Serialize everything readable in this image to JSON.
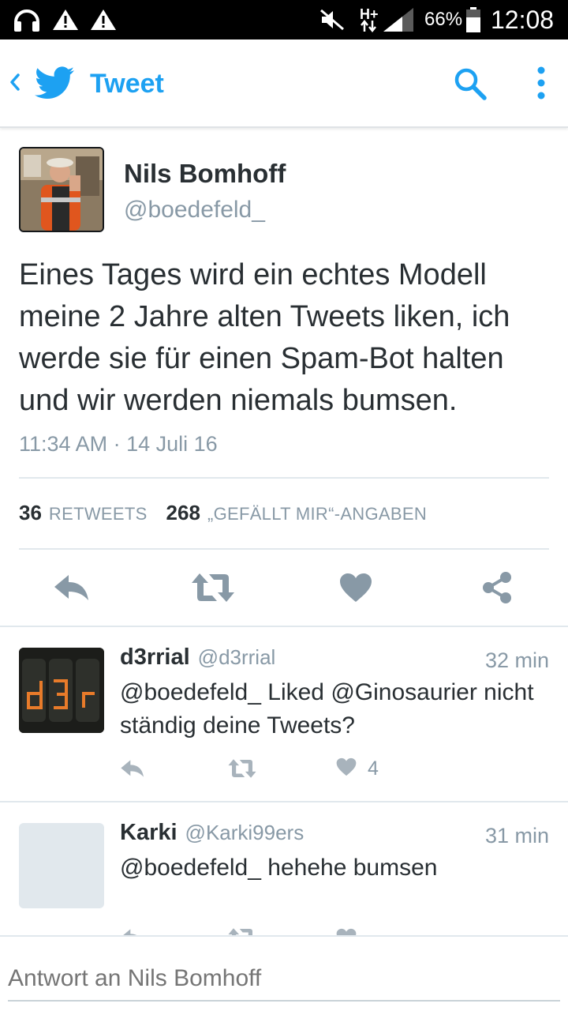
{
  "status_bar": {
    "network_type": "H+",
    "battery": "66%",
    "time": "12:08",
    "icons": [
      "headset-icon",
      "warning-icon",
      "warning-icon",
      "mute-icon",
      "signal-icon",
      "battery-icon"
    ]
  },
  "app_bar": {
    "title": "Tweet",
    "icons": [
      "back-chevron-icon",
      "twitter-bird-icon",
      "search-icon",
      "more-vert-icon"
    ],
    "accent_color": "#1da1f2"
  },
  "tweet": {
    "author_name": "Nils Bomhoff",
    "author_handle": "@boedefeld_",
    "text": "Eines Tages wird ein echtes Modell meine 2 Jahre alten Tweets liken, ich werde sie für einen Spam-Bot halten und wir werden niemals bumsen.",
    "timestamp": "11:34 AM · 14 Juli 16",
    "retweet_count": "36",
    "retweet_label": "RETWEETS",
    "like_count": "268",
    "like_label": "„GEFÄLLT MIR“-ANGABEN",
    "action_icons": [
      "reply-icon",
      "retweet-icon",
      "heart-icon",
      "share-icon"
    ]
  },
  "replies": [
    {
      "name": "d3rrial",
      "handle": "@d3rrial",
      "time": "32 min",
      "text": "@boedefeld_ Liked @Ginosaurier nicht ständig deine Tweets?",
      "like_count": "4",
      "avatar_text": "d3r"
    },
    {
      "name": "Karki",
      "handle": "@Karki99ers",
      "time": "31 min",
      "text": "@boedefeld_ hehehe bumsen",
      "like_count": ""
    }
  ],
  "compose": {
    "placeholder": "Antwort an Nils Bomhoff"
  },
  "colors": {
    "text_primary": "#292f33",
    "text_secondary": "#8899a6",
    "icon_gray": "#8899a6",
    "divider": "#e1e8ed"
  }
}
